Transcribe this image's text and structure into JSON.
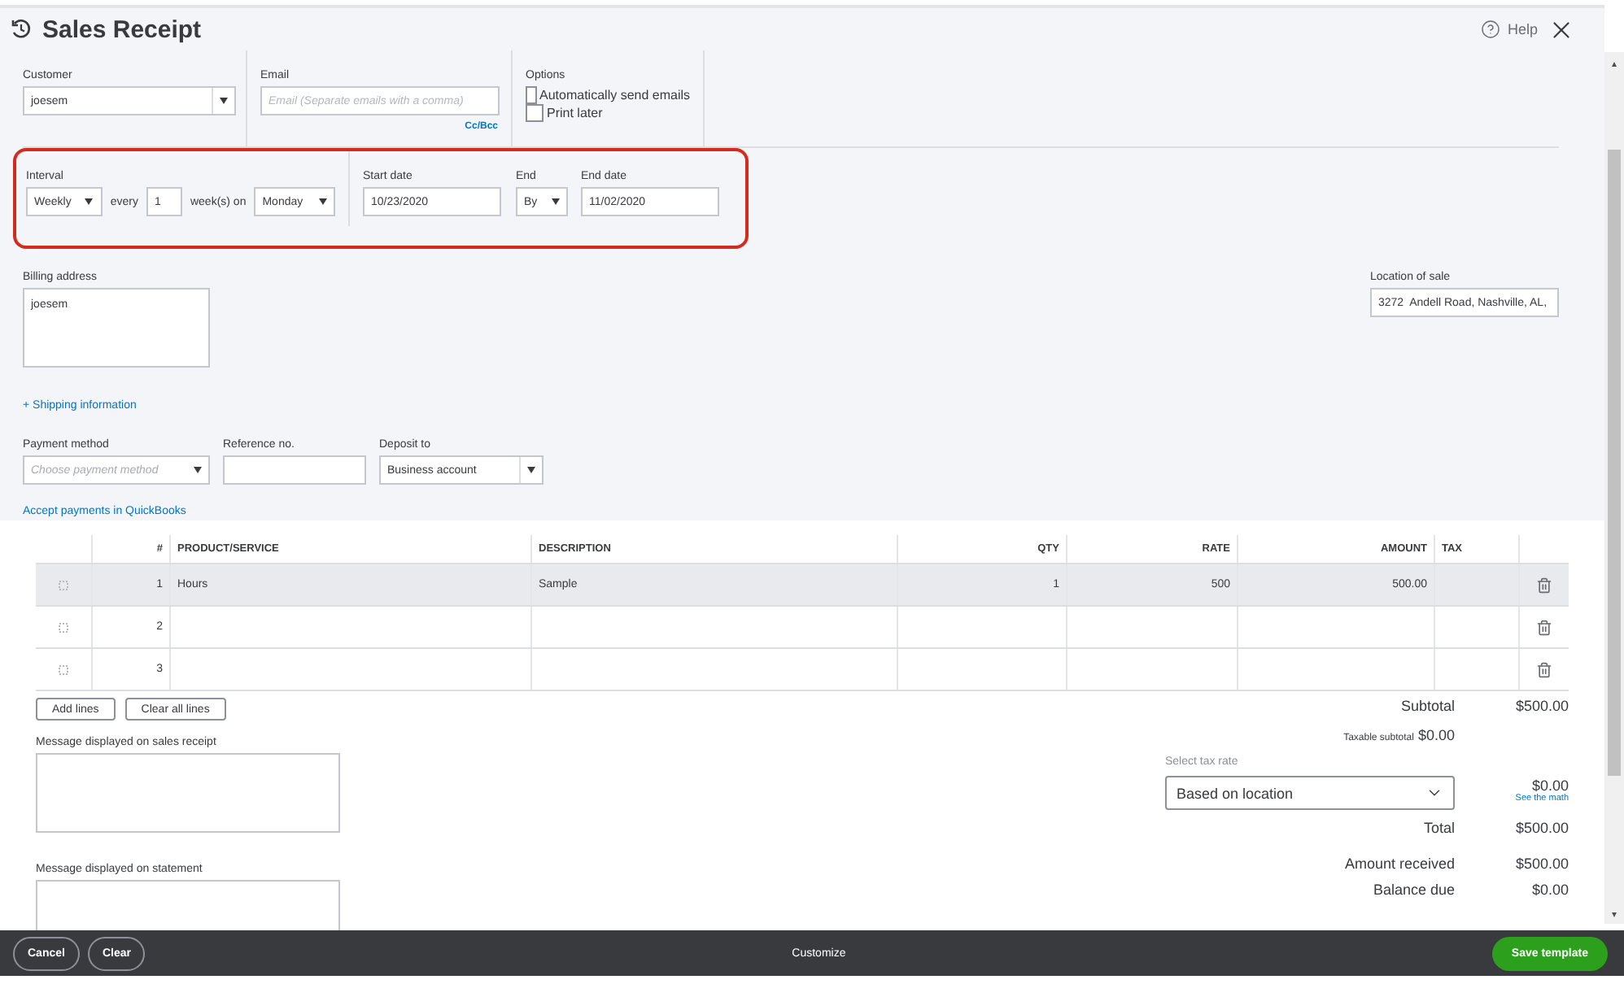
{
  "title": "Sales Receipt",
  "help": "Help",
  "customer": {
    "label": "Customer",
    "value": "joesem"
  },
  "email": {
    "label": "Email",
    "placeholder": "Email (Separate emails with a comma)",
    "cc_link": "Cc/Bcc"
  },
  "options": {
    "label": "Options",
    "items": [
      {
        "label": "Automatically send emails",
        "checked": false
      },
      {
        "label": "Print later",
        "checked": false
      }
    ]
  },
  "recurrence": {
    "interval_label": "Interval",
    "interval": "Weekly",
    "every_label": "every",
    "every": "1",
    "unit_label": "week(s) on",
    "day": "Monday",
    "start_label": "Start date",
    "start": "10/23/2020",
    "end_label": "End",
    "end": "By",
    "end_date_label": "End date",
    "end_date": "11/02/2020"
  },
  "billing": {
    "label": "Billing address",
    "value": "joesem"
  },
  "location": {
    "label": "Location of sale",
    "value": "3272  Andell Road, Nashville, AL,"
  },
  "shipping_link": "+ Shipping information",
  "payment": {
    "method_label": "Payment method",
    "method_placeholder": "Choose payment method",
    "reference_label": "Reference no.",
    "deposit_label": "Deposit to",
    "deposit": "Business account",
    "accept_link": "Accept payments in QuickBooks"
  },
  "table": {
    "columns": [
      {
        "label": "#"
      },
      {
        "label": "PRODUCT/SERVICE"
      },
      {
        "label": "DESCRIPTION"
      },
      {
        "label": "QTY"
      },
      {
        "label": "RATE"
      },
      {
        "label": "AMOUNT"
      },
      {
        "label": "TAX"
      }
    ],
    "rows": [
      {
        "number": "1",
        "product": "Hours",
        "description": "Sample",
        "qty": "1",
        "rate": "500",
        "amount": "500.00",
        "selected": true
      },
      {
        "number": "2",
        "selected": false
      },
      {
        "number": "3",
        "selected": false
      }
    ]
  },
  "line_buttons": [
    "Add lines",
    "Clear all lines"
  ],
  "messages": [
    {
      "label": "Message displayed on sales receipt"
    },
    {
      "label": "Message displayed on statement"
    }
  ],
  "totals": {
    "subtotal_label": "Subtotal",
    "subtotal": "$500.00",
    "taxable_label": "Taxable subtotal",
    "taxable": "$0.00",
    "tax_rate_label": "Select tax rate",
    "tax_rate": "Based on location",
    "tax": "$0.00",
    "see_math": "See the math",
    "total_label": "Total",
    "total": "$500.00",
    "received_label": "Amount received",
    "received": "$500.00",
    "balance_label": "Balance due",
    "balance": "$0.00"
  },
  "footer": {
    "cancel": "Cancel",
    "clear": "Clear",
    "customize": "Customize",
    "save": "Save template"
  }
}
